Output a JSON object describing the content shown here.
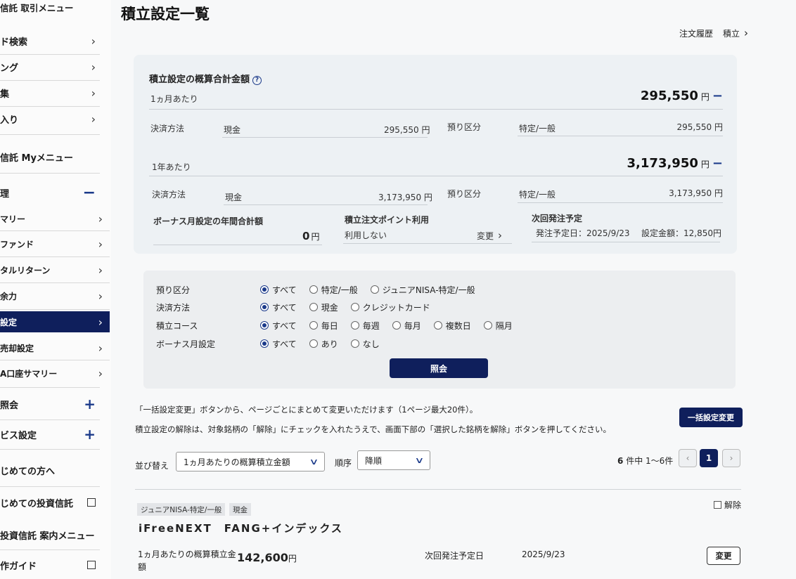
{
  "sidebar": {
    "items": [
      {
        "label": "信託 取引メニュー",
        "icon": ""
      },
      {
        "label": "ド検索",
        "icon": "chevron-right"
      },
      {
        "label": "ング",
        "icon": "chevron-right"
      },
      {
        "label": "集",
        "icon": "chevron-right"
      },
      {
        "label": "入り",
        "icon": "chevron-right"
      },
      {
        "label": "信託 Myメニュー",
        "icon": ""
      },
      {
        "label": "理",
        "icon": "minus"
      },
      {
        "label": "マリー",
        "icon": "chevron-right"
      },
      {
        "label": "ファンド",
        "icon": "chevron-right"
      },
      {
        "label": "タルリターン",
        "icon": "chevron-right"
      },
      {
        "label": "余力",
        "icon": "chevron-right"
      },
      {
        "label": "設定",
        "icon": "chevron-right",
        "active": true
      },
      {
        "label": "売却設定",
        "icon": "chevron-right"
      },
      {
        "label": "A口座サマリー",
        "icon": "chevron-right"
      },
      {
        "label": "照会",
        "icon": "plus"
      },
      {
        "label": "ビス設定",
        "icon": "plus"
      },
      {
        "label": "じめての方へ",
        "icon": ""
      },
      {
        "label": "じめての投資信託",
        "icon": "external-link"
      },
      {
        "label": "投資信託 案内メニュー",
        "icon": ""
      },
      {
        "label": "作ガイド",
        "icon": "external-link"
      }
    ]
  },
  "header": {
    "title": "積立設定一覧",
    "link_history": "注文履歴",
    "link_tsumitate": "積立"
  },
  "summary": {
    "title": "積立設定の概算合計金額",
    "help": "?",
    "monthly": {
      "period": "1ヵ月あたり",
      "total": "295,550",
      "yen": "円",
      "payment_label": "決済方法",
      "payment_value": "現金",
      "payment_amount": "295,550",
      "deposit_label": "預り区分",
      "deposit_value": "特定/一般",
      "deposit_amount": "295,550"
    },
    "yearly": {
      "period": "1年あたり",
      "total": "3,173,950",
      "yen": "円",
      "payment_label": "決済方法",
      "payment_value": "現金",
      "payment_amount": "3,173,950",
      "deposit_label": "預り区分",
      "deposit_value": "特定/一般",
      "deposit_amount": "3,173,950"
    },
    "bonus": {
      "label": "ボーナス月設定の年間合計額",
      "amount": "0",
      "yen": "円"
    },
    "points": {
      "label": "積立注文ポイント利用",
      "value": "利用しない",
      "change": "変更"
    },
    "next": {
      "label": "次回発注予定",
      "date": "発注予定日：2025/9/23",
      "amount": "設定金額：12,850円"
    },
    "collapse_icon": "minus-icon"
  },
  "filter": {
    "rows": [
      {
        "label": "預り区分",
        "options": [
          "すべて",
          "特定/一般",
          "ジュニアNISA-特定/一般"
        ],
        "selected": 0
      },
      {
        "label": "決済方法",
        "options": [
          "すべて",
          "現金",
          "クレジットカード"
        ],
        "selected": 0
      },
      {
        "label": "積立コース",
        "options": [
          "すべて",
          "毎日",
          "毎週",
          "毎月",
          "複数日",
          "隔月"
        ],
        "selected": 0
      },
      {
        "label": "ボーナス月設定",
        "options": [
          "すべて",
          "あり",
          "なし"
        ],
        "selected": 0
      }
    ],
    "search_label": "照会"
  },
  "notes": {
    "line1": "「一括設定変更」ボタンから、ページごとにまとめて変更いただけます（1ページ最大20件）。",
    "line2": "積立設定の解除は、対象銘柄の「解除」にチェックを入れたうえで、画面下部の「選択した銘柄を解除」ボタンを押してください。",
    "bulk_button": "一括設定変更"
  },
  "sort": {
    "label": "並び替え",
    "value": "1ヵ月あたりの概算積立金額",
    "order_label": "順序",
    "order_value": "降順"
  },
  "pager": {
    "count": "6",
    "count_suffix": "件中 1〜6件",
    "prev": "‹",
    "current": "1",
    "next": "›"
  },
  "fund": {
    "tag_account": "ジュニアNISA-特定/一般",
    "tag_payment": "現金",
    "cancel_label": "解除",
    "name": "iFreeNEXT　FANG+インデックス",
    "amount_label": "1ヵ月あたりの概算積立金額",
    "amount": "142,600",
    "yen": "円",
    "next_label": "次回発注予定日",
    "next_date": "2025/9/23",
    "change_button": "変更"
  },
  "colors": {
    "accent": "#0f1f5c",
    "link": "#1b3a8a",
    "panel": "#edf1f4"
  }
}
